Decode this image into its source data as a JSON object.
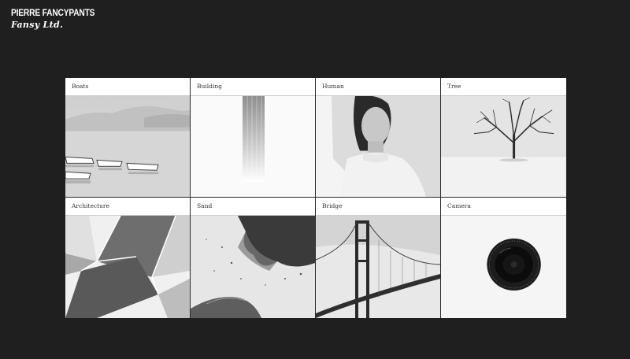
{
  "brand": {
    "name": "PIERRE FANCYPANTS",
    "subtitle": "Fansy Ltd."
  },
  "gallery": {
    "tiles": [
      {
        "label": "Boats"
      },
      {
        "label": "Building"
      },
      {
        "label": "Human"
      },
      {
        "label": "Tree"
      },
      {
        "label": "Architecture"
      },
      {
        "label": "Sand"
      },
      {
        "label": "Bridge"
      },
      {
        "label": "Camera"
      }
    ]
  },
  "colors": {
    "background": "#1f1f1f",
    "tile": "#ffffff",
    "brand_text": "#ffffff"
  }
}
